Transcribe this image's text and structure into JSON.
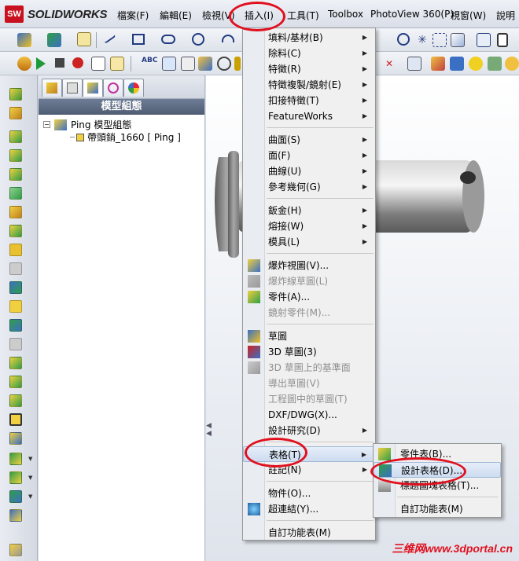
{
  "app": {
    "logo_badge": "SW",
    "logo_text": "SOLIDWORKS"
  },
  "menubar": {
    "items": [
      "檔案(F)",
      "編輯(E)",
      "檢視(V)",
      "插入(I)",
      "工具(T)",
      "Toolbox",
      "PhotoView 360(P)",
      "視窗(W)",
      "說明"
    ]
  },
  "feature_manager": {
    "title": "模型組態",
    "tree": [
      {
        "label": "Ping 模型組態"
      },
      {
        "label": "帶頭銷_1660 [ Ping ]"
      }
    ]
  },
  "insert_menu": {
    "groups": [
      [
        {
          "label": "填料/基材(B)",
          "submenu": true
        },
        {
          "label": "除料(C)",
          "submenu": true
        },
        {
          "label": "特徵(R)",
          "submenu": true
        },
        {
          "label": "特徵複製/鏡射(E)",
          "submenu": true
        },
        {
          "label": "扣接特徵(T)",
          "submenu": true
        },
        {
          "label": "FeatureWorks",
          "submenu": true
        }
      ],
      [
        {
          "label": "曲面(S)",
          "submenu": true
        },
        {
          "label": "面(F)",
          "submenu": true
        },
        {
          "label": "曲線(U)",
          "submenu": true
        },
        {
          "label": "參考幾何(G)",
          "submenu": true
        }
      ],
      [
        {
          "label": "鈑金(H)",
          "submenu": true
        },
        {
          "label": "熔接(W)",
          "submenu": true
        },
        {
          "label": "模具(L)",
          "submenu": true
        }
      ],
      [
        {
          "label": "爆炸視圖(V)...",
          "icon": "explode-view-icon"
        },
        {
          "label": "爆炸線草圖(L)",
          "disabled": true,
          "icon": "explode-line-icon"
        },
        {
          "label": "零件(A)...",
          "icon": "part-icon"
        },
        {
          "label": "鏡射零件(M)...",
          "disabled": true
        }
      ],
      [
        {
          "label": "草圖",
          "icon": "sketch-icon"
        },
        {
          "label": "3D 草圖(3)",
          "icon": "3d-sketch-icon"
        },
        {
          "label": "3D 草圖上的基準面",
          "disabled": true,
          "icon": "3d-sketch-plane-icon"
        },
        {
          "label": "導出草圖(V)",
          "disabled": true
        },
        {
          "label": "工程圖中的草圖(T)",
          "disabled": true
        },
        {
          "label": "DXF/DWG(X)..."
        },
        {
          "label": "設計研究(D)",
          "submenu": true
        }
      ],
      [
        {
          "label": "表格(T)",
          "submenu": true,
          "highlight": true
        },
        {
          "label": "註記(N)",
          "submenu": true
        }
      ],
      [
        {
          "label": "物件(O)..."
        },
        {
          "label": "超連結(Y)...",
          "icon": "hyperlink-icon"
        }
      ],
      [
        {
          "label": "自訂功能表(M)"
        }
      ]
    ]
  },
  "tables_submenu": {
    "items": [
      {
        "label": "零件表(B)...",
        "icon": "bom-icon"
      },
      {
        "label": "設計表格(D)...",
        "icon": "design-table-icon",
        "highlight": true
      },
      {
        "label": "標題圖塊表格(T)...",
        "icon": "title-block-icon"
      },
      {
        "label": "自訂功能表(M)"
      }
    ]
  },
  "watermark": "三维网www.3dportal.cn"
}
